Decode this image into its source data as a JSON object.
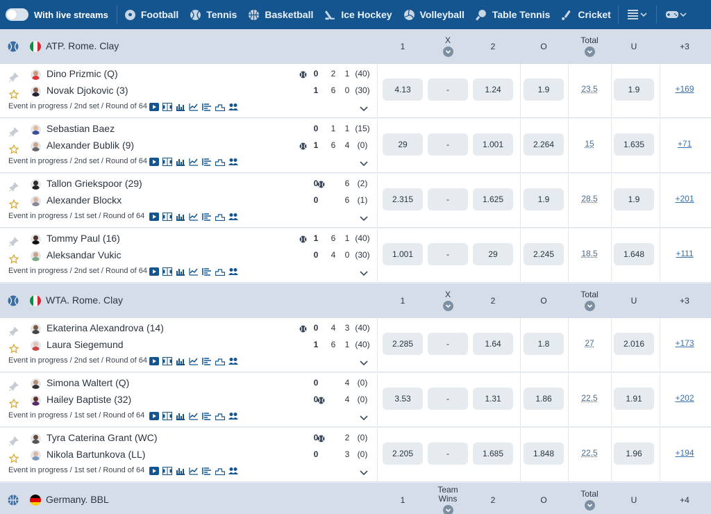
{
  "nav": {
    "live_label": "With live streams",
    "items": [
      {
        "label": "Football",
        "icon": "football-icon"
      },
      {
        "label": "Tennis",
        "icon": "tennis-icon"
      },
      {
        "label": "Basketball",
        "icon": "basketball-icon"
      },
      {
        "label": "Ice Hockey",
        "icon": "ice-hockey-icon"
      },
      {
        "label": "Volleyball",
        "icon": "volleyball-icon"
      },
      {
        "label": "Table Tennis",
        "icon": "table-tennis-icon"
      },
      {
        "label": "Cricket",
        "icon": "cricket-icon"
      }
    ]
  },
  "sections": [
    {
      "league": "ATP. Rome. Clay",
      "flag": "italy",
      "sport": "tennis",
      "cols": {
        "c1": "1",
        "cx": "X",
        "c2": "2",
        "o": "O",
        "total": "Total",
        "u": "U",
        "more": "+3"
      },
      "matches": [
        {
          "p1": "Dino Prizmic (Q)",
          "p2": "Novak Djokovic (3)",
          "status": "Event in progress / 2nd set / Round of 64",
          "serve": 1,
          "s1": [
            "0",
            "2",
            "1",
            "(40)"
          ],
          "s2": [
            "1",
            "6",
            "0",
            "(30)"
          ],
          "odds": {
            "o1": "4.13",
            "x": "-",
            "o2": "1.24",
            "over": "1.9",
            "total": "23.5",
            "under": "1.9",
            "more": "+169"
          }
        },
        {
          "p1": "Sebastian Baez",
          "p2": "Alexander Bublik (9)",
          "status": "Event in progress / 2nd set / Round of 64",
          "serve": 2,
          "s1": [
            "0",
            "1",
            "1",
            "(15)"
          ],
          "s2": [
            "1",
            "6",
            "4",
            "(0)"
          ],
          "odds": {
            "o1": "29",
            "x": "-",
            "o2": "1.001",
            "over": "2.264",
            "total": "15",
            "under": "1.635",
            "more": "+71"
          }
        },
        {
          "p1": "Tallon Griekspoor (29)",
          "p2": "Alexander Blockx",
          "status": "Event in progress / 1st set / Round of 64",
          "serve": 1,
          "s1": [
            "0",
            "",
            "6",
            "(2)"
          ],
          "s2": [
            "0",
            "",
            "6",
            "(1)"
          ],
          "odds": {
            "o1": "2.315",
            "x": "-",
            "o2": "1.625",
            "over": "1.9",
            "total": "28.5",
            "under": "1.9",
            "more": "+201"
          }
        },
        {
          "p1": "Tommy Paul (16)",
          "p2": "Aleksandar Vukic",
          "status": "Event in progress / 2nd set / Round of 64",
          "serve": 1,
          "s1": [
            "1",
            "6",
            "1",
            "(40)"
          ],
          "s2": [
            "0",
            "4",
            "0",
            "(30)"
          ],
          "odds": {
            "o1": "1.001",
            "x": "-",
            "o2": "29",
            "over": "2.245",
            "total": "18.5",
            "under": "1.648",
            "more": "+111"
          }
        }
      ]
    },
    {
      "league": "WTA. Rome. Clay",
      "flag": "italy",
      "sport": "tennis",
      "cols": {
        "c1": "1",
        "cx": "X",
        "c2": "2",
        "o": "O",
        "total": "Total",
        "u": "U",
        "more": "+3"
      },
      "matches": [
        {
          "p1": "Ekaterina Alexandrova (14)",
          "p2": "Laura Siegemund",
          "status": "Event in progress / 2nd set / Round of 64",
          "serve": 1,
          "s1": [
            "0",
            "4",
            "3",
            "(40)"
          ],
          "s2": [
            "1",
            "6",
            "1",
            "(40)"
          ],
          "odds": {
            "o1": "2.285",
            "x": "-",
            "o2": "1.64",
            "over": "1.8",
            "total": "27",
            "under": "2.016",
            "more": "+173"
          }
        },
        {
          "p1": "Simona Waltert (Q)",
          "p2": "Hailey Baptiste (32)",
          "status": "Event in progress / 1st set / Round of 64",
          "serve": 2,
          "s1": [
            "0",
            "",
            "4",
            "(0)"
          ],
          "s2": [
            "0",
            "",
            "4",
            "(0)"
          ],
          "odds": {
            "o1": "3.53",
            "x": "-",
            "o2": "1.31",
            "over": "1.86",
            "total": "22.5",
            "under": "1.91",
            "more": "+202"
          }
        },
        {
          "p1": "Tyra Caterina Grant (WC)",
          "p2": "Nikola Bartunkova (LL)",
          "status": "Event in progress / 1st set / Round of 64",
          "serve": 1,
          "s1": [
            "0",
            "",
            "2",
            "(0)"
          ],
          "s2": [
            "0",
            "",
            "3",
            "(0)"
          ],
          "odds": {
            "o1": "2.205",
            "x": "-",
            "o2": "1.685",
            "over": "1.848",
            "total": "22.5",
            "under": "1.96",
            "more": "+194"
          }
        }
      ]
    },
    {
      "league": "Germany. BBL",
      "flag": "germany",
      "sport": "basketball",
      "cols": {
        "c1": "1",
        "cx": "Team Wins",
        "c2": "2",
        "o": "O",
        "total": "Total",
        "u": "U",
        "more": "+4"
      },
      "matches": []
    }
  ],
  "colors": {
    "nav": "#14558f",
    "section": "#d5dee8",
    "odd_bg": "#e6ebf0",
    "link": "#3470ab"
  }
}
